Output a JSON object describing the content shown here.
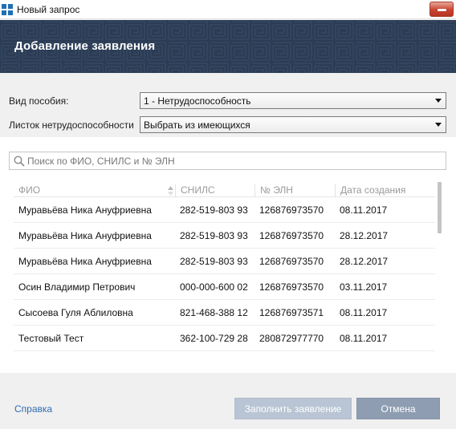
{
  "window": {
    "title": "Новый запрос",
    "icon": "app-grid-icon",
    "close_icon": "close-icon"
  },
  "header": {
    "title": "Добавление заявления"
  },
  "form": {
    "benefit_type": {
      "label": "Вид пособия:",
      "selected": "1 - Нетрудоспособность"
    },
    "sick_leave": {
      "label": "Листок нетрудоспособности",
      "selected": "Выбрать из имеющихся"
    }
  },
  "search": {
    "placeholder": "Поиск по ФИО, СНИЛС и № ЭЛН",
    "value": ""
  },
  "table": {
    "columns": [
      "ФИО",
      "СНИЛС",
      "№ ЭЛН",
      "Дата создания"
    ],
    "sorted_column": "ФИО",
    "rows": [
      [
        "Муравьёва Ника Ануфриевна",
        "282-519-803 93",
        "126876973570",
        "08.11.2017"
      ],
      [
        "Муравьёва Ника Ануфриевна",
        "282-519-803 93",
        "126876973570",
        "28.12.2017"
      ],
      [
        "Муравьёва Ника Ануфриевна",
        "282-519-803 93",
        "126876973570",
        "28.12.2017"
      ],
      [
        "Осин Владимир Петрович",
        "000-000-600 02",
        "126876973570",
        "03.11.2017"
      ],
      [
        "Сысоева Гуля Аблиловна",
        "821-468-388 12",
        "126876973571",
        "08.11.2017"
      ],
      [
        "Тестовый Тест",
        "362-100-729 28",
        "280872977770",
        "08.11.2017"
      ]
    ]
  },
  "footer": {
    "help_label": "Справка",
    "fill_label": "Заполнить заявление",
    "cancel_label": "Отмена"
  },
  "colors": {
    "banner": "#2c3c54",
    "link": "#2f6cb3",
    "disabled_button": "#b9c5d4",
    "cancel_button": "#8e9db1"
  }
}
